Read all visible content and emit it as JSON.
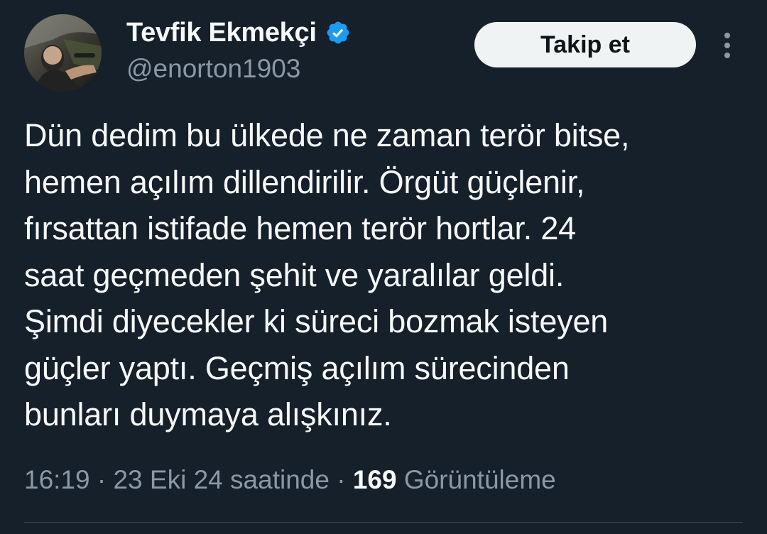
{
  "author": {
    "display_name": "Tevfik Ekmekçi",
    "handle": "@enorton1903",
    "verified_icon": "verified-badge-icon",
    "verified_color": "#1d9bf0"
  },
  "actions": {
    "follow_label": "Takip et",
    "more_icon": "more-vertical-icon"
  },
  "tweet": {
    "lines": [
      "Dün dedim bu ülkede ne zaman terör bitse,",
      "hemen açılım dillendirilir. Örgüt güçlenir,",
      "fırsattan istifade hemen terör hortlar. 24",
      "saat geçmeden şehit ve yaralılar geldi.",
      "Şimdi diyecekler ki süreci bozmak isteyen",
      "güçler yaptı. Geçmiş açılım sürecinden",
      "bunları duymaya alışkınız."
    ]
  },
  "meta": {
    "time": "16:19",
    "sep1": " · ",
    "date": "23 Eki 24 saatinde",
    "sep2": " · ",
    "views_count": "169",
    "views_label": " Görüntüleme"
  },
  "colors": {
    "background": "#15202b",
    "text_primary": "#f7f9f9",
    "text_secondary": "#8b98a5",
    "button_bg": "#eff3f4",
    "divider": "#38444d"
  }
}
